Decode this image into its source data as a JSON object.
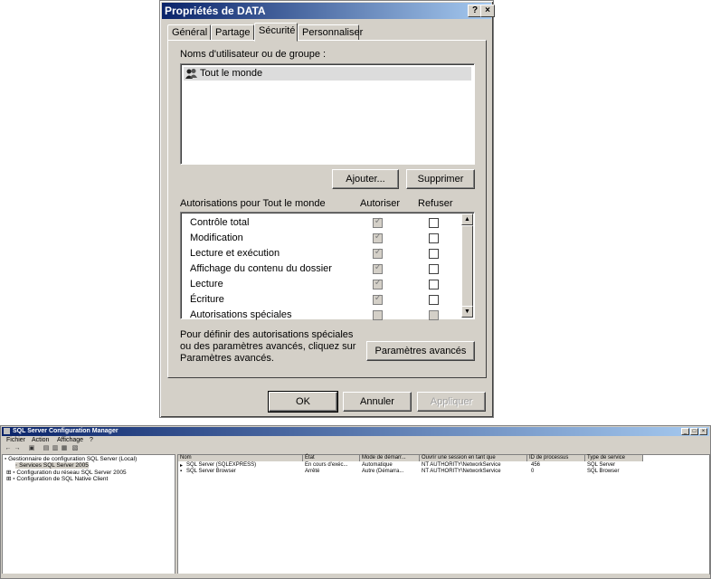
{
  "dialog": {
    "title": "Propriétés de DATA",
    "help_btn": "?",
    "close_btn": "×",
    "tabs": [
      "Général",
      "Partage",
      "Sécurité",
      "Personnaliser"
    ],
    "active_tab": "Sécurité",
    "users_label": "Noms d'utilisateur ou de groupe :",
    "users": [
      {
        "name": "Tout le monde",
        "icon": "group-icon"
      }
    ],
    "add_button": "Ajouter...",
    "remove_button": "Supprimer",
    "permissions_label": "Autorisations pour Tout le monde",
    "allow_header": "Autoriser",
    "deny_header": "Refuser",
    "permissions": [
      {
        "name": "Contrôle total",
        "allow": true,
        "deny": false
      },
      {
        "name": "Modification",
        "allow": true,
        "deny": false
      },
      {
        "name": "Lecture et exécution",
        "allow": true,
        "deny": false
      },
      {
        "name": "Affichage du contenu du dossier",
        "allow": true,
        "deny": false
      },
      {
        "name": "Lecture",
        "allow": true,
        "deny": false
      },
      {
        "name": "Écriture",
        "allow": true,
        "deny": false
      },
      {
        "name": "Autorisations spéciales",
        "allow": false,
        "deny": false
      }
    ],
    "advanced_text_1": "Pour définir des autorisations spéciales",
    "advanced_text_2": "ou des paramètres avancés, cliquez sur",
    "advanced_text_3": "Paramètres avancés.",
    "advanced_button": "Paramètres avancés",
    "ok_button": "OK",
    "cancel_button": "Annuler",
    "apply_button": "Appliquer"
  },
  "mmc": {
    "title": "SQL Server Configuration Manager",
    "menu": [
      "Fichier",
      "Action",
      "Affichage",
      "?"
    ],
    "tree": [
      "Gestionnaire de configuration SQL Server (Local)",
      "Services SQL Server 2005",
      "Configuration du réseau SQL Server 2005",
      "Configuration de SQL Native Client"
    ],
    "columns": [
      "Nom",
      "État",
      "Mode de démarr...",
      "Ouvrir une session en tant que",
      "ID de processus",
      "Type de service"
    ],
    "rows": [
      [
        "SQL Server (SQLEXPRESS)",
        "En cours d'exéc...",
        "Automatique",
        "NT AUTHORITY\\NetworkService",
        "456",
        "SQL Server"
      ],
      [
        "SQL Server Browser",
        "Arrêté",
        "Autre (Démarra...",
        "NT AUTHORITY\\NetworkService",
        "0",
        "SQL Browser"
      ]
    ]
  }
}
